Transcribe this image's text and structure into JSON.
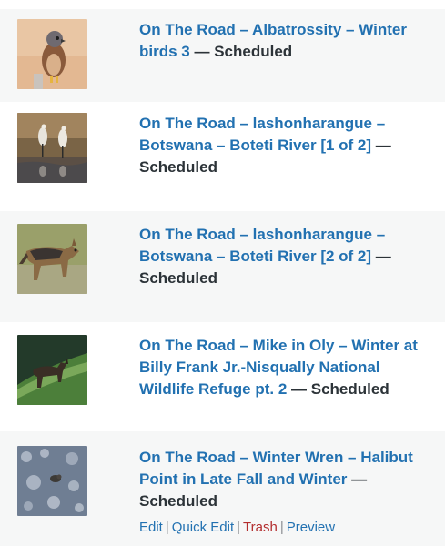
{
  "posts": [
    {
      "title": "On The Road – Albatrossity – Winter birds 3",
      "separator": " — ",
      "status": "Scheduled",
      "thumb": "kestrel-thumbnail"
    },
    {
      "title": "On The Road – lashonharangue – Botswana – Boteti River [1 of 2]",
      "separator": " — ",
      "status": "Scheduled",
      "thumb": "herons-thumbnail"
    },
    {
      "title": "On The Road – lashonharangue – Botswana – Boteti River [2 of 2]",
      "separator": " — ",
      "status": "Scheduled",
      "thumb": "jackal-thumbnail"
    },
    {
      "title": "On The Road – Mike in Oly – Winter at Billy Frank Jr.-Nisqually National Wildlife Refuge pt. 2",
      "separator": " — ",
      "status": "Scheduled",
      "thumb": "deer-thumbnail"
    },
    {
      "title": "On The Road – Winter Wren – Halibut Point in Late Fall and Winter",
      "separator": " — ",
      "status": "Scheduled",
      "thumb": "wren-thumbnail"
    }
  ],
  "row_actions": {
    "edit": "Edit",
    "quick_edit": "Quick Edit",
    "trash": "Trash",
    "preview": "Preview",
    "pipe": "|"
  },
  "colors": {
    "link": "#2271b1",
    "trash": "#b32d2e",
    "alt_row": "#f6f7f7"
  }
}
